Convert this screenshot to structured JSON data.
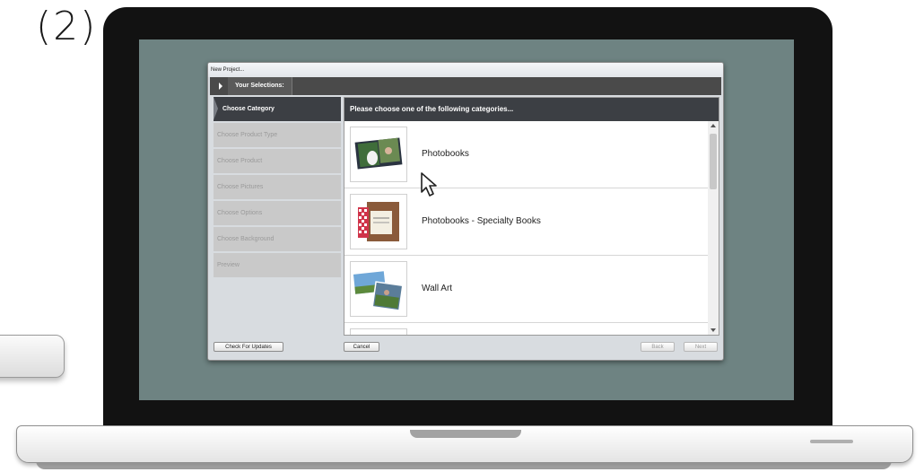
{
  "step_label": "(2)",
  "window": {
    "title": "New Project...",
    "breadcrumb_label": "Your Selections:"
  },
  "sidebar": {
    "items": [
      {
        "label": "Choose Category",
        "active": true
      },
      {
        "label": "Choose Product Type",
        "active": false
      },
      {
        "label": "Choose Product",
        "active": false
      },
      {
        "label": "Choose Pictures",
        "active": false
      },
      {
        "label": "Choose Options",
        "active": false
      },
      {
        "label": "Choose Background",
        "active": false
      },
      {
        "label": "Preview",
        "active": false
      }
    ]
  },
  "main": {
    "header": "Please choose one of the following categories...",
    "categories": [
      {
        "label": "Photobooks",
        "icon": "photobook-thumbnail"
      },
      {
        "label": "Photobooks - Specialty Books",
        "icon": "specialty-book-thumbnail"
      },
      {
        "label": "Wall Art",
        "icon": "wall-art-thumbnail"
      }
    ]
  },
  "footer": {
    "check_updates": "Check For Updates",
    "cancel": "Cancel",
    "back": "Back",
    "next": "Next"
  },
  "colors": {
    "screen": "#6e8382",
    "dark_header": "#3c3f44",
    "sidebar_item": "#c9c9c9"
  }
}
